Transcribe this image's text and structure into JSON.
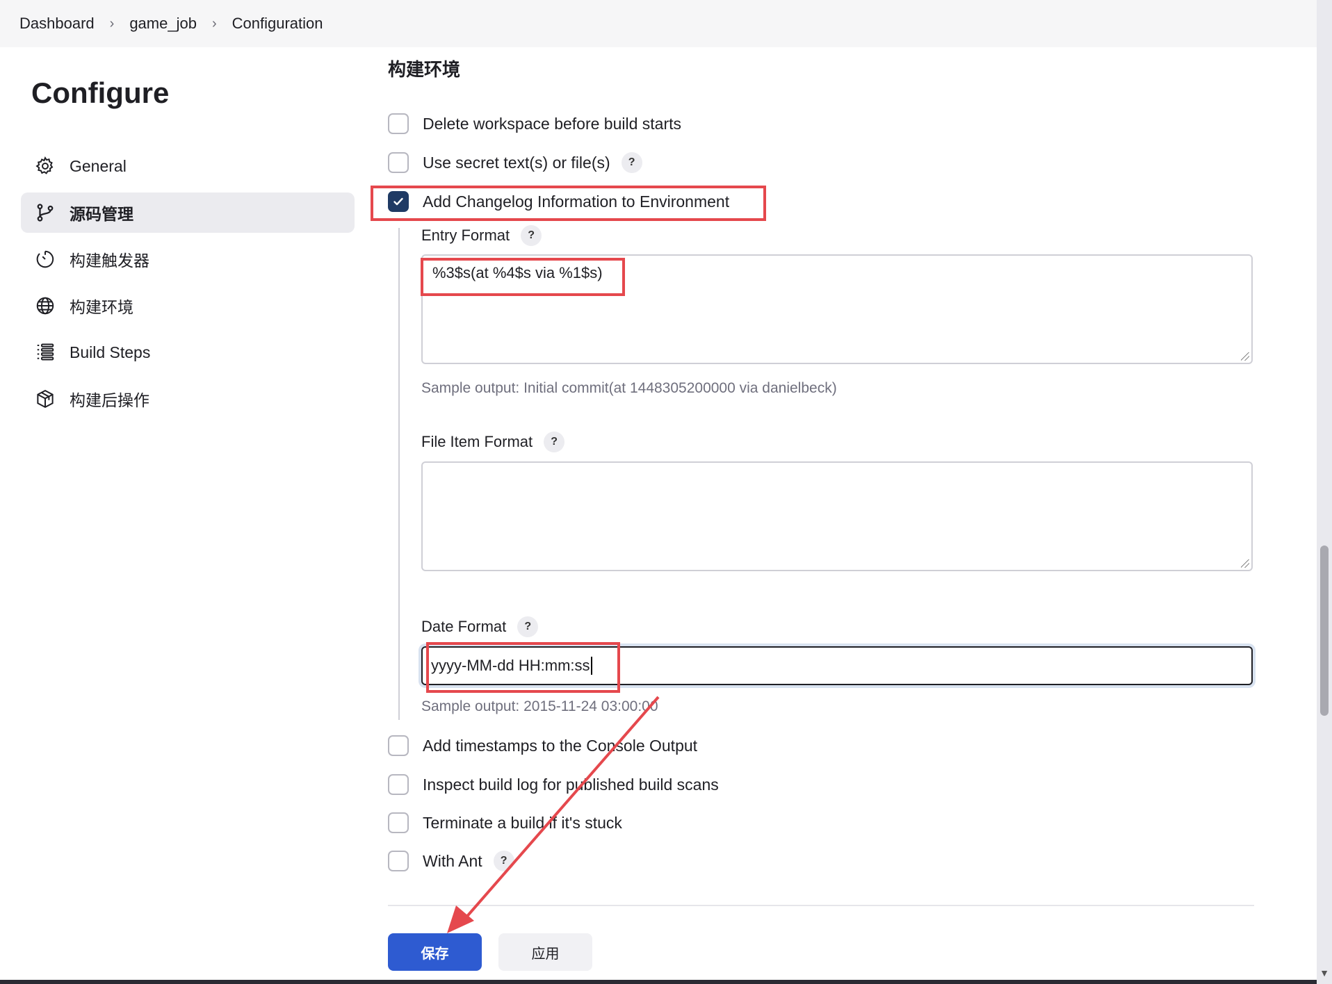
{
  "breadcrumb": [
    "Dashboard",
    "game_job",
    "Configuration"
  ],
  "sidebar": {
    "title": "Configure",
    "items": [
      {
        "label": "General",
        "icon": "gear-icon",
        "active": false
      },
      {
        "label": "源码管理",
        "icon": "branch-icon",
        "active": true
      },
      {
        "label": "构建触发器",
        "icon": "timer-icon",
        "active": false
      },
      {
        "label": "构建环境",
        "icon": "globe-icon",
        "active": false
      },
      {
        "label": "Build Steps",
        "icon": "list-icon",
        "active": false
      },
      {
        "label": "构建后操作",
        "icon": "package-icon",
        "active": false
      }
    ]
  },
  "main": {
    "section_title": "构建环境",
    "options": {
      "delete_workspace": {
        "label": "Delete workspace before build starts",
        "checked": false
      },
      "secret_text": {
        "label": "Use secret text(s) or file(s)",
        "checked": false
      },
      "changelog": {
        "label": "Add Changelog Information to Environment",
        "checked": true
      },
      "timestamps": {
        "label": "Add timestamps to the Console Output",
        "checked": false
      },
      "inspect_log": {
        "label": "Inspect build log for published build scans",
        "checked": false
      },
      "terminate": {
        "label": "Terminate a build if it's stuck",
        "checked": false
      },
      "with_ant": {
        "label": "With Ant",
        "checked": false
      }
    },
    "entry_format": {
      "label": "Entry Format",
      "value": "%3$s(at %4$s via %1$s)",
      "sample": "Sample output: Initial commit(at 1448305200000 via danielbeck)"
    },
    "file_item_format": {
      "label": "File Item Format",
      "value": ""
    },
    "date_format": {
      "label": "Date Format",
      "value": "yyyy-MM-dd HH:mm:ss",
      "sample": "Sample output: 2015-11-24 03:00:00"
    },
    "help_glyph": "?"
  },
  "buttons": {
    "save": "保存",
    "apply": "应用"
  },
  "colors": {
    "primary": "#2e5bd1",
    "checked": "#1f3a64",
    "annotation": "#e5484d"
  }
}
